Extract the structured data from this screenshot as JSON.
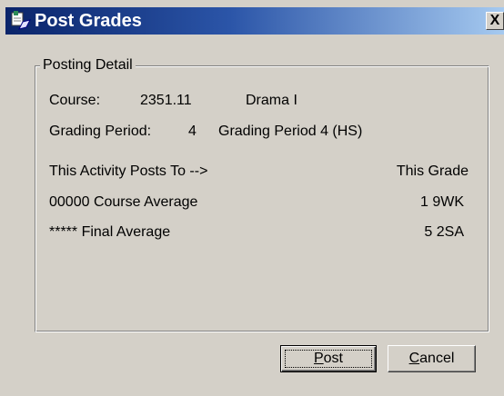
{
  "window": {
    "title": "Post Grades",
    "close_symbol": "X",
    "app_icon": "grades-app-icon"
  },
  "posting_detail": {
    "legend": "Posting Detail",
    "course_label": "Course:",
    "course_number": "2351.11",
    "course_name": "Drama I",
    "grading_period_label": "Grading Period:",
    "grading_period_number": "4",
    "grading_period_name": "Grading Period 4 (HS)",
    "posts_to_header": "This Activity Posts To -->",
    "this_grade_header": "This Grade",
    "rows": [
      {
        "name": "00000 Course Average",
        "grade": "1 9WK"
      },
      {
        "name": "***** Final Average",
        "grade": "5 2SA"
      }
    ]
  },
  "buttons": {
    "post_mnemonic": "P",
    "post_rest": "ost",
    "cancel_mnemonic": "C",
    "cancel_rest": "ancel"
  },
  "colors": {
    "titlebar_start": "#0a246a",
    "titlebar_end": "#a6caf0",
    "face": "#d4d0c8"
  }
}
